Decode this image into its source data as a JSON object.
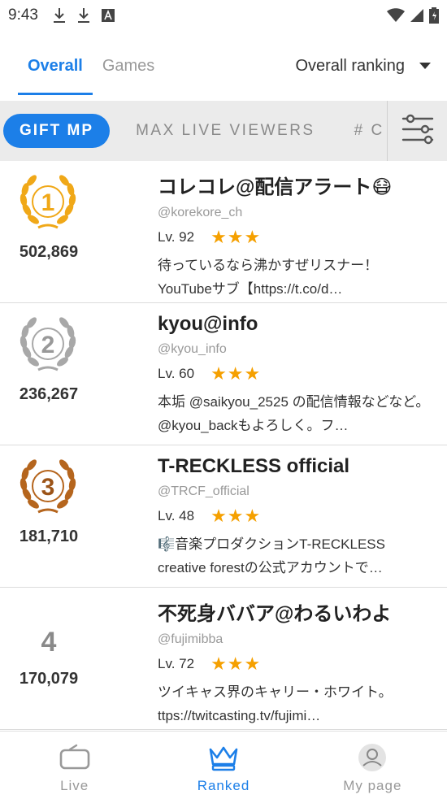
{
  "status_bar": {
    "time": "9:43"
  },
  "tabs": [
    {
      "label": "Overall",
      "active": true
    },
    {
      "label": "Games",
      "active": false
    }
  ],
  "ranking_select": {
    "value": "Overall ranking"
  },
  "filters": [
    {
      "label": "GIFT MP",
      "active": true
    },
    {
      "label": "MAX LIVE VIEWERS",
      "active": false
    },
    {
      "label": "# C",
      "active": false
    }
  ],
  "rankings": [
    {
      "rank": "1",
      "score": "502,869",
      "name": "コレコレ@配信アラート😷",
      "handle": "@korekore_ch",
      "level": "Lv. 92",
      "stars": "★★★",
      "description": "待っているなら沸かすぜリスナー！ YouTubeサブ【https://t.co/d…"
    },
    {
      "rank": "2",
      "score": "236,267",
      "name": "kyou@info",
      "handle": "@kyou_info",
      "level": "Lv. 60",
      "stars": "★★★",
      "description": "本垢 @saikyou_2525 の配信情報などなど。@kyou_backもよろしく。フ…"
    },
    {
      "rank": "3",
      "score": "181,710",
      "name": "T-RECKLESS official",
      "handle": "@TRCF_official",
      "level": "Lv. 48",
      "stars": "★★★",
      "description": "🎼音楽プロダクションT-RECKLESS creative forestの公式アカウントで…"
    },
    {
      "rank": "4",
      "score": "170,079",
      "name": "不死身ババア@わるいわよ",
      "handle": "@fujimibba",
      "level": "Lv. 72",
      "stars": "★★★",
      "description": "ツイキャス界のキャリー・ホワイト。 ttps://twitcasting.tv/fujimi…"
    }
  ],
  "bottom_nav": [
    {
      "label": "Live",
      "icon": "tv-icon",
      "active": false
    },
    {
      "label": "Ranked",
      "icon": "crown-icon",
      "active": true
    },
    {
      "label": "My page",
      "icon": "avatar-icon",
      "active": false
    }
  ],
  "colors": {
    "accent": "#1c7fe8",
    "gold": "#f0a818",
    "silver": "#a8a8a8",
    "bronze": "#b5651d",
    "stars": "#f5a000"
  }
}
